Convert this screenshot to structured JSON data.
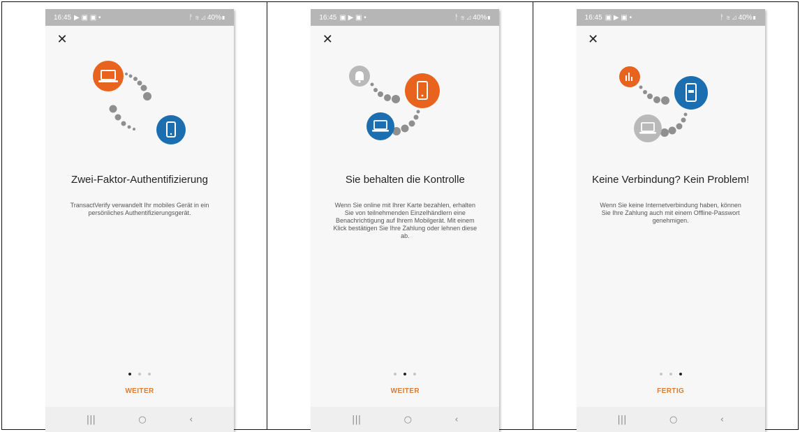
{
  "colors": {
    "orange": "#e8641e",
    "blue": "#1b6fb1",
    "grey_circle": "#b9b9b9",
    "dot_grey": "#8f8f8f",
    "action_orange": "#e07a2c"
  },
  "icons": {
    "close": "close-icon",
    "recents": "recents-icon",
    "home": "home-icon",
    "back": "back-icon"
  },
  "screens": [
    {
      "status": {
        "time": "16:45",
        "left_icons": "▶ ▣ ▣ •",
        "right_icons": "ᚨ ≋ ⊿ 40%▮"
      },
      "title": "Zwei-Faktor-Authentifizierung",
      "description": "TransactVerify verwandelt Ihr mobiles Gerät in ein persönliches Authentifizierungsgerät.",
      "action": "WEITER"
    },
    {
      "status": {
        "time": "16:45",
        "left_icons": "▣ ▶ ▣ •",
        "right_icons": "ᚨ ≋ ⊿ 40%▮"
      },
      "title": "Sie behalten die Kontrolle",
      "description": "Wenn Sie online mit Ihrer Karte bezahlen, erhalten Sie von teilnehmenden Einzelhändlern eine Benachrichtigung auf Ihrem Mobilgerät. Mit einem Klick bestätigen Sie Ihre Zahlung oder lehnen diese ab.",
      "action": "WEITER"
    },
    {
      "status": {
        "time": "16:45",
        "left_icons": "▣ ▶ ▣ •",
        "right_icons": "ᚨ ≋ ⊿ 40%▮"
      },
      "title": "Keine Verbindung? Kein Problem!",
      "description": "Wenn Sie keine Internetverbindung haben, können Sie Ihre Zahlung auch mit einem Offline-Passwort genehmigen.",
      "action": "FERTIG"
    }
  ]
}
